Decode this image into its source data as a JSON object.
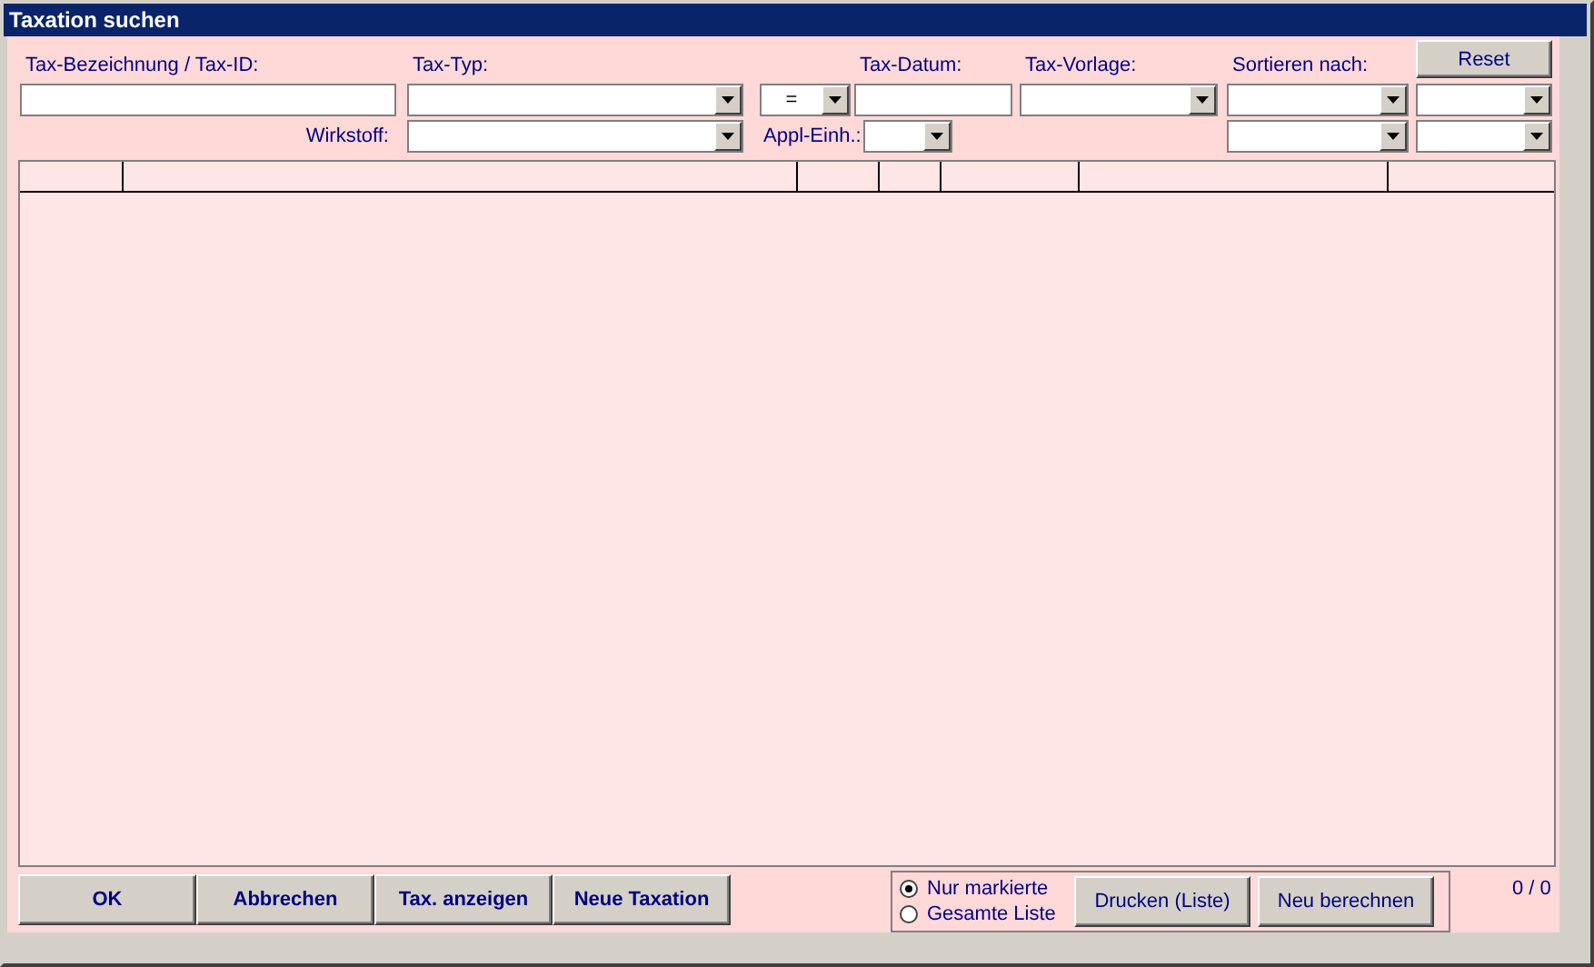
{
  "window": {
    "title": "Taxation suchen"
  },
  "filters": {
    "name": {
      "label": "Tax-Bezeichnung / Tax-ID:"
    },
    "type": {
      "label": "Tax-Typ:"
    },
    "operator": {
      "value": "="
    },
    "date": {
      "label": "Tax-Datum:"
    },
    "template": {
      "label": "Tax-Vorlage:"
    },
    "sort": {
      "label": "Sortieren nach:"
    },
    "substance": {
      "label": "Wirkstoff:"
    },
    "unit": {
      "label": "Appl-Einh.:"
    },
    "reset_button": "Reset"
  },
  "actions": [
    "OK",
    "Abbrechen",
    "Tax. anzeigen",
    "Neue Taxation"
  ],
  "print_scope": [
    {
      "label": "Nur markierte",
      "selected": true
    },
    {
      "label": "Gesamte Liste",
      "selected": false
    }
  ],
  "print_buttons": [
    "Drucken (Liste)",
    "Neu berechnen"
  ],
  "counter": "0 / 0"
}
